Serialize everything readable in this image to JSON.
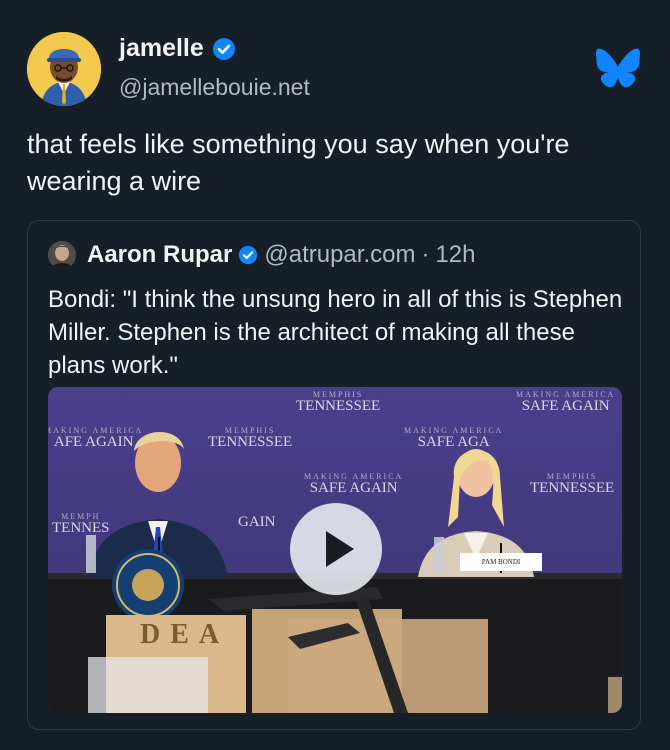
{
  "post": {
    "display_name": "jamelle",
    "handle": "@jamellebouie.net",
    "text": "that feels like something you say when you're wearing a wire",
    "icons": {
      "verified": "verified-check-icon",
      "logo": "bluesky-butterfly-icon"
    }
  },
  "quote": {
    "display_name": "Aaron Rupar",
    "handle": "@atrupar.com",
    "separator": "·",
    "time": "12h",
    "text": "Bondi: \"I think the unsung hero in all of this is Stephen Miller. Stephen is the architect of making all these plans work.\"",
    "video": {
      "backdrop_small": "MAKING AMERICA",
      "backdrop_city": "MEMPHIS",
      "backdrop_state": "TENNESSEE",
      "backdrop_slogan": "SAFE AGAIN",
      "slogan_partial_1": "GAIN",
      "slogan_partial_2": "SAFE AGA",
      "city_partial": "MEMPH",
      "state_partial": "TENNES",
      "slogan_cropped": "AFE AGAIN",
      "nameplate": "PAM BONDI",
      "crate_label": "DEA",
      "play_icon": "play-icon"
    }
  },
  "colors": {
    "background": "#161e27",
    "accent": "#1185fe",
    "muted_text": "#aebbc9",
    "border": "#2c3a4a"
  }
}
